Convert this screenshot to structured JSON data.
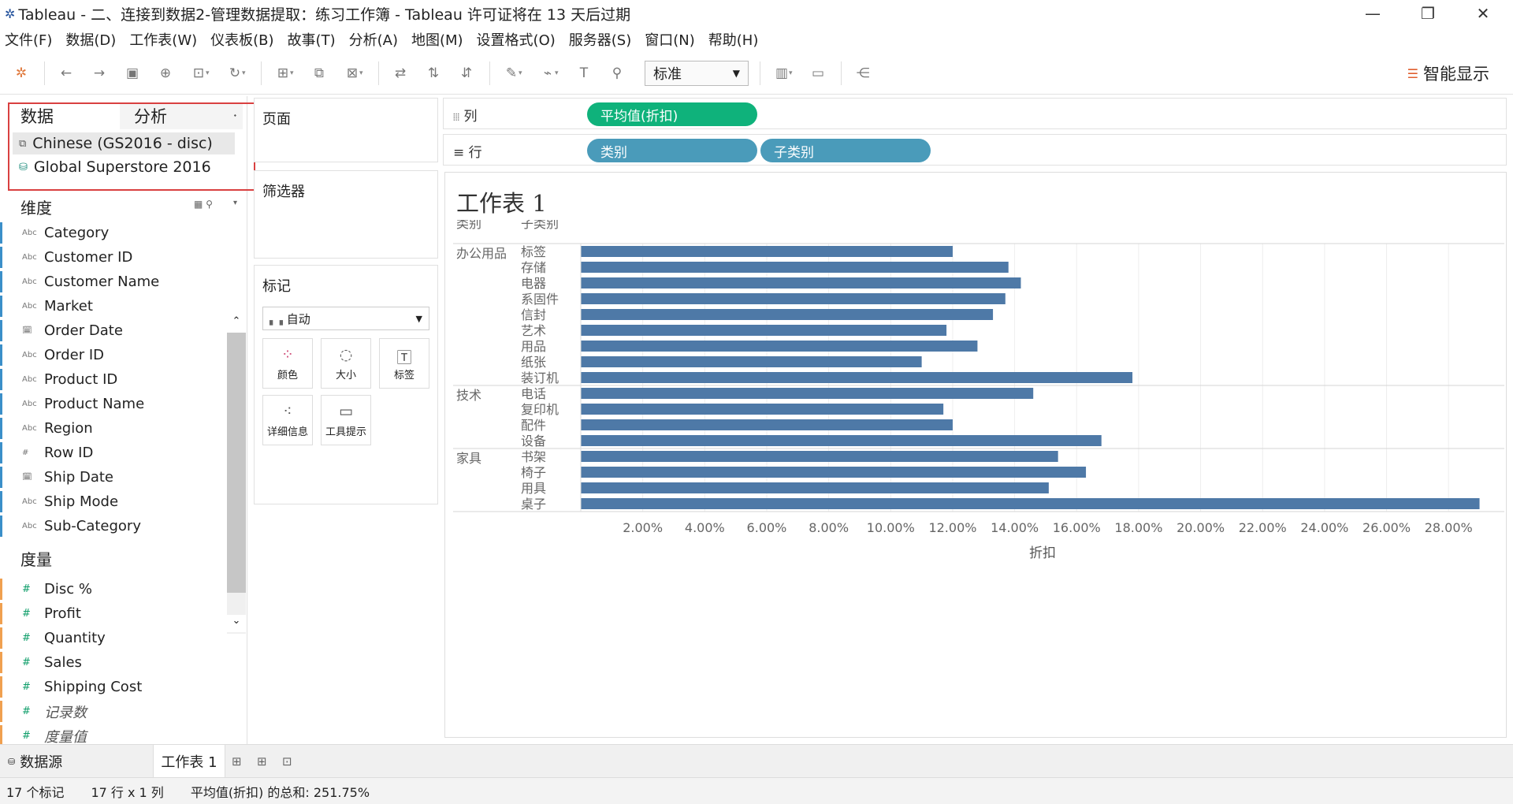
{
  "window": {
    "title": "Tableau - 二、连接到数据2-管理数据提取：练习工作簿 - Tableau 许可证将在 13 天后过期"
  },
  "menu": [
    "文件(F)",
    "数据(D)",
    "工作表(W)",
    "仪表板(B)",
    "故事(T)",
    "分析(A)",
    "地图(M)",
    "设置格式(O)",
    "服务器(S)",
    "窗口(N)",
    "帮助(H)"
  ],
  "toolbar": {
    "fit_value": "标准",
    "show_me": "智能显示"
  },
  "left_panel": {
    "tabs": {
      "data": "数据",
      "analysis": "分析"
    },
    "datasources": [
      "Chinese (GS2016 - disc)",
      "Global Superstore 2016"
    ],
    "dimensions_header": "维度",
    "dimensions": [
      {
        "name": "Category",
        "type": "Abc"
      },
      {
        "name": "Customer ID",
        "type": "Abc"
      },
      {
        "name": "Customer Name",
        "type": "Abc"
      },
      {
        "name": "Market",
        "type": "Abc"
      },
      {
        "name": "Order Date",
        "type": "date"
      },
      {
        "name": "Order ID",
        "type": "Abc"
      },
      {
        "name": "Product ID",
        "type": "Abc"
      },
      {
        "name": "Product Name",
        "type": "Abc"
      },
      {
        "name": "Region",
        "type": "Abc"
      },
      {
        "name": "Row ID",
        "type": "#"
      },
      {
        "name": "Ship Date",
        "type": "date"
      },
      {
        "name": "Ship Mode",
        "type": "Abc"
      },
      {
        "name": "Sub-Category",
        "type": "Abc"
      }
    ],
    "measures_header": "度量",
    "measures": [
      {
        "name": "Disc %",
        "italic": false
      },
      {
        "name": "Profit",
        "italic": false
      },
      {
        "name": "Quantity",
        "italic": false
      },
      {
        "name": "Sales",
        "italic": false
      },
      {
        "name": "Shipping Cost",
        "italic": false
      },
      {
        "name": "记录数",
        "italic": true
      },
      {
        "name": "度量值",
        "italic": true
      }
    ]
  },
  "cards": {
    "pages": "页面",
    "filters": "筛选器",
    "marks": "标记",
    "mark_type": "自动",
    "mark_buttons": [
      "颜色",
      "大小",
      "标签",
      "详细信息",
      "工具提示"
    ]
  },
  "shelves": {
    "columns_label": "列",
    "rows_label": "行",
    "columns": [
      "平均值(折扣)"
    ],
    "rows": [
      "类别",
      "子类别"
    ]
  },
  "sheet": {
    "title": "工作表 1"
  },
  "chart_data": {
    "type": "bar",
    "orientation": "horizontal",
    "row_headers": [
      "类别",
      "子类别"
    ],
    "groups": [
      {
        "name": "办公用品",
        "categories": [
          "标签",
          "存储",
          "电器",
          "系固件",
          "信封",
          "艺术",
          "用品",
          "纸张",
          "装订机"
        ],
        "values": [
          12.0,
          13.8,
          14.2,
          13.7,
          13.3,
          11.8,
          12.8,
          11.0,
          17.8
        ]
      },
      {
        "name": "技术",
        "categories": [
          "电话",
          "复印机",
          "配件",
          "设备"
        ],
        "values": [
          14.6,
          11.7,
          12.0,
          16.8
        ]
      },
      {
        "name": "家具",
        "categories": [
          "书架",
          "椅子",
          "用具",
          "桌子"
        ],
        "values": [
          15.4,
          16.3,
          15.1,
          29.0
        ]
      }
    ],
    "xlabel": "折扣",
    "xticks": [
      "2.00%",
      "4.00%",
      "6.00%",
      "8.00%",
      "10.00%",
      "12.00%",
      "14.00%",
      "16.00%",
      "18.00%",
      "20.00%",
      "22.00%",
      "24.00%",
      "26.00%",
      "28.00%"
    ],
    "xlim": [
      0,
      29.8
    ],
    "bar_color": "#4e79a7"
  },
  "bottom_tabs": {
    "datasource": "数据源",
    "sheet": "工作表 1"
  },
  "status": {
    "marks": "17 个标记",
    "dims": "17 行 x 1 列",
    "sum": "平均值(折扣) 的总和: 251.75%"
  }
}
